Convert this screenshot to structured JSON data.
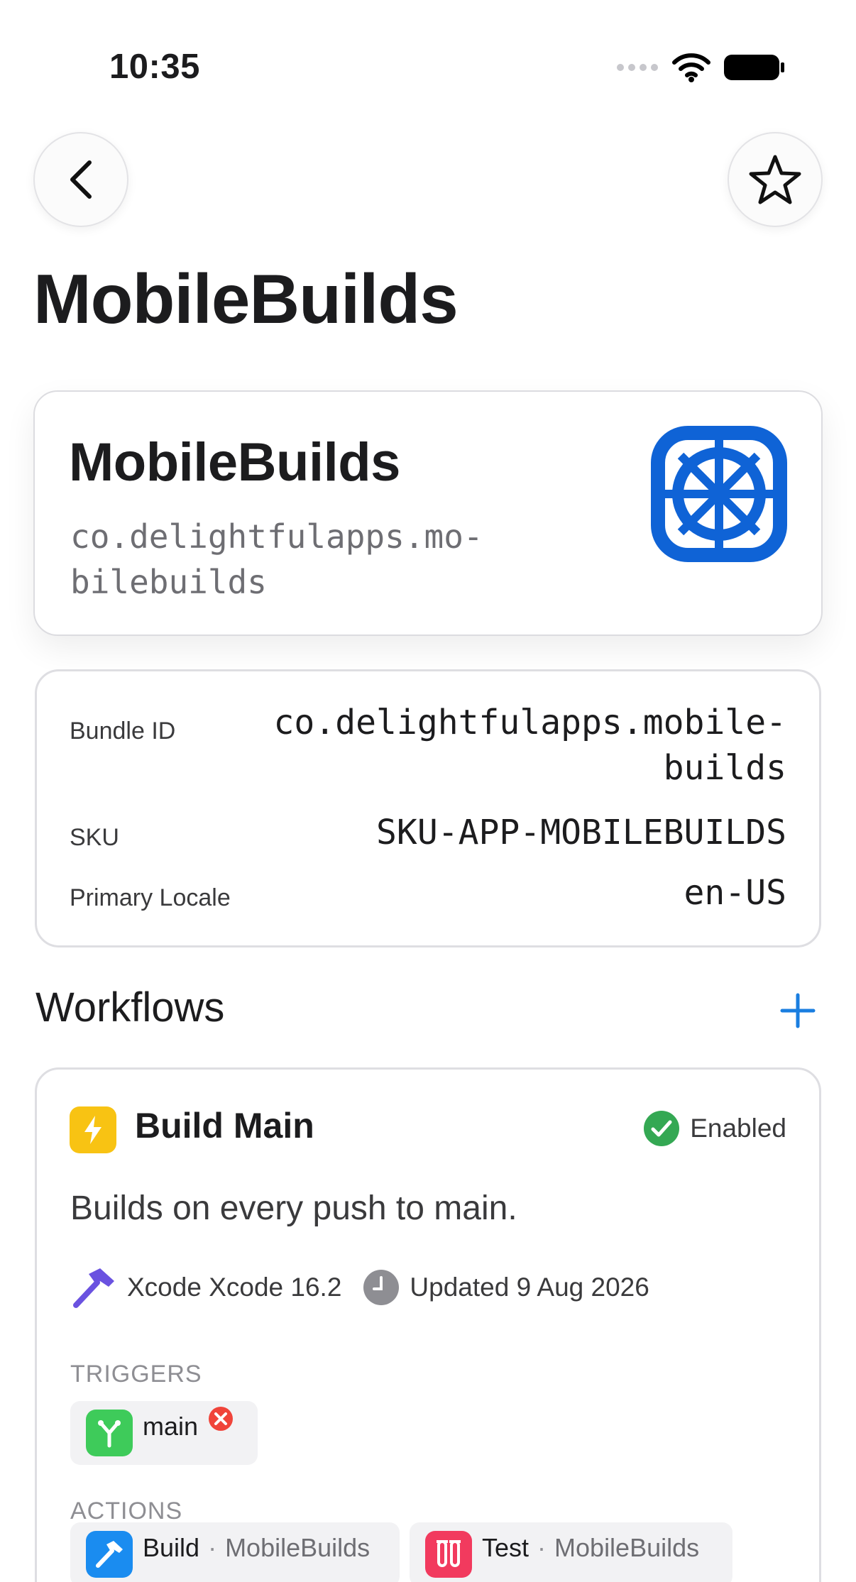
{
  "status_bar": {
    "time": "10:35"
  },
  "page": {
    "title": "MobileBuilds"
  },
  "hero": {
    "name": "MobileBuilds",
    "bundle_line1": "co.delightfulapps.mo-",
    "bundle_line2": "bilebuilds"
  },
  "details": {
    "bundle_id_label": "Bundle ID",
    "bundle_id_line1": "co.delightfulapps.mobile-",
    "bundle_id_line2": "builds",
    "sku_label": "SKU",
    "sku_value": "SKU-APP-MOBILEBUILDS",
    "locale_label": "Primary Locale",
    "locale_value": "en-US"
  },
  "workflows": {
    "title": "Workflows",
    "items": [
      {
        "name": "Build Main",
        "status": "Enabled",
        "description": "Builds on every push to main.",
        "xcode": "Xcode Xcode 16.2",
        "updated": "Updated 9 Aug 2026",
        "triggers_label": "TRIGGERS",
        "triggers": [
          {
            "branch": "main"
          }
        ],
        "actions_label": "ACTIONS",
        "actions": [
          {
            "name": "Build",
            "target": "MobileBuilds"
          },
          {
            "name": "Test",
            "target": "MobileBuilds"
          }
        ]
      }
    ]
  },
  "colors": {
    "accent": "#1a7ee0",
    "app_icon": "#0f63d6",
    "enabled": "#34a853",
    "workflow_icon": "#f8c313",
    "trigger_icon": "#3ecb5a",
    "remove": "#f0443a",
    "build_icon": "#1a8cf0",
    "test_icon": "#f23a5e",
    "hammer": "#6a52e0"
  },
  "icons": {
    "back": "chevron-left-icon",
    "favorite": "star-icon",
    "app": "wheel-icon",
    "add": "plus-icon",
    "workflow": "bolt-icon",
    "enabled": "checkmark-circle-icon",
    "xcode": "hammer-icon",
    "updated": "clock-icon",
    "trigger": "branch-icon",
    "remove": "x-circle-icon",
    "build": "hammer-icon",
    "test": "test-tubes-icon"
  }
}
